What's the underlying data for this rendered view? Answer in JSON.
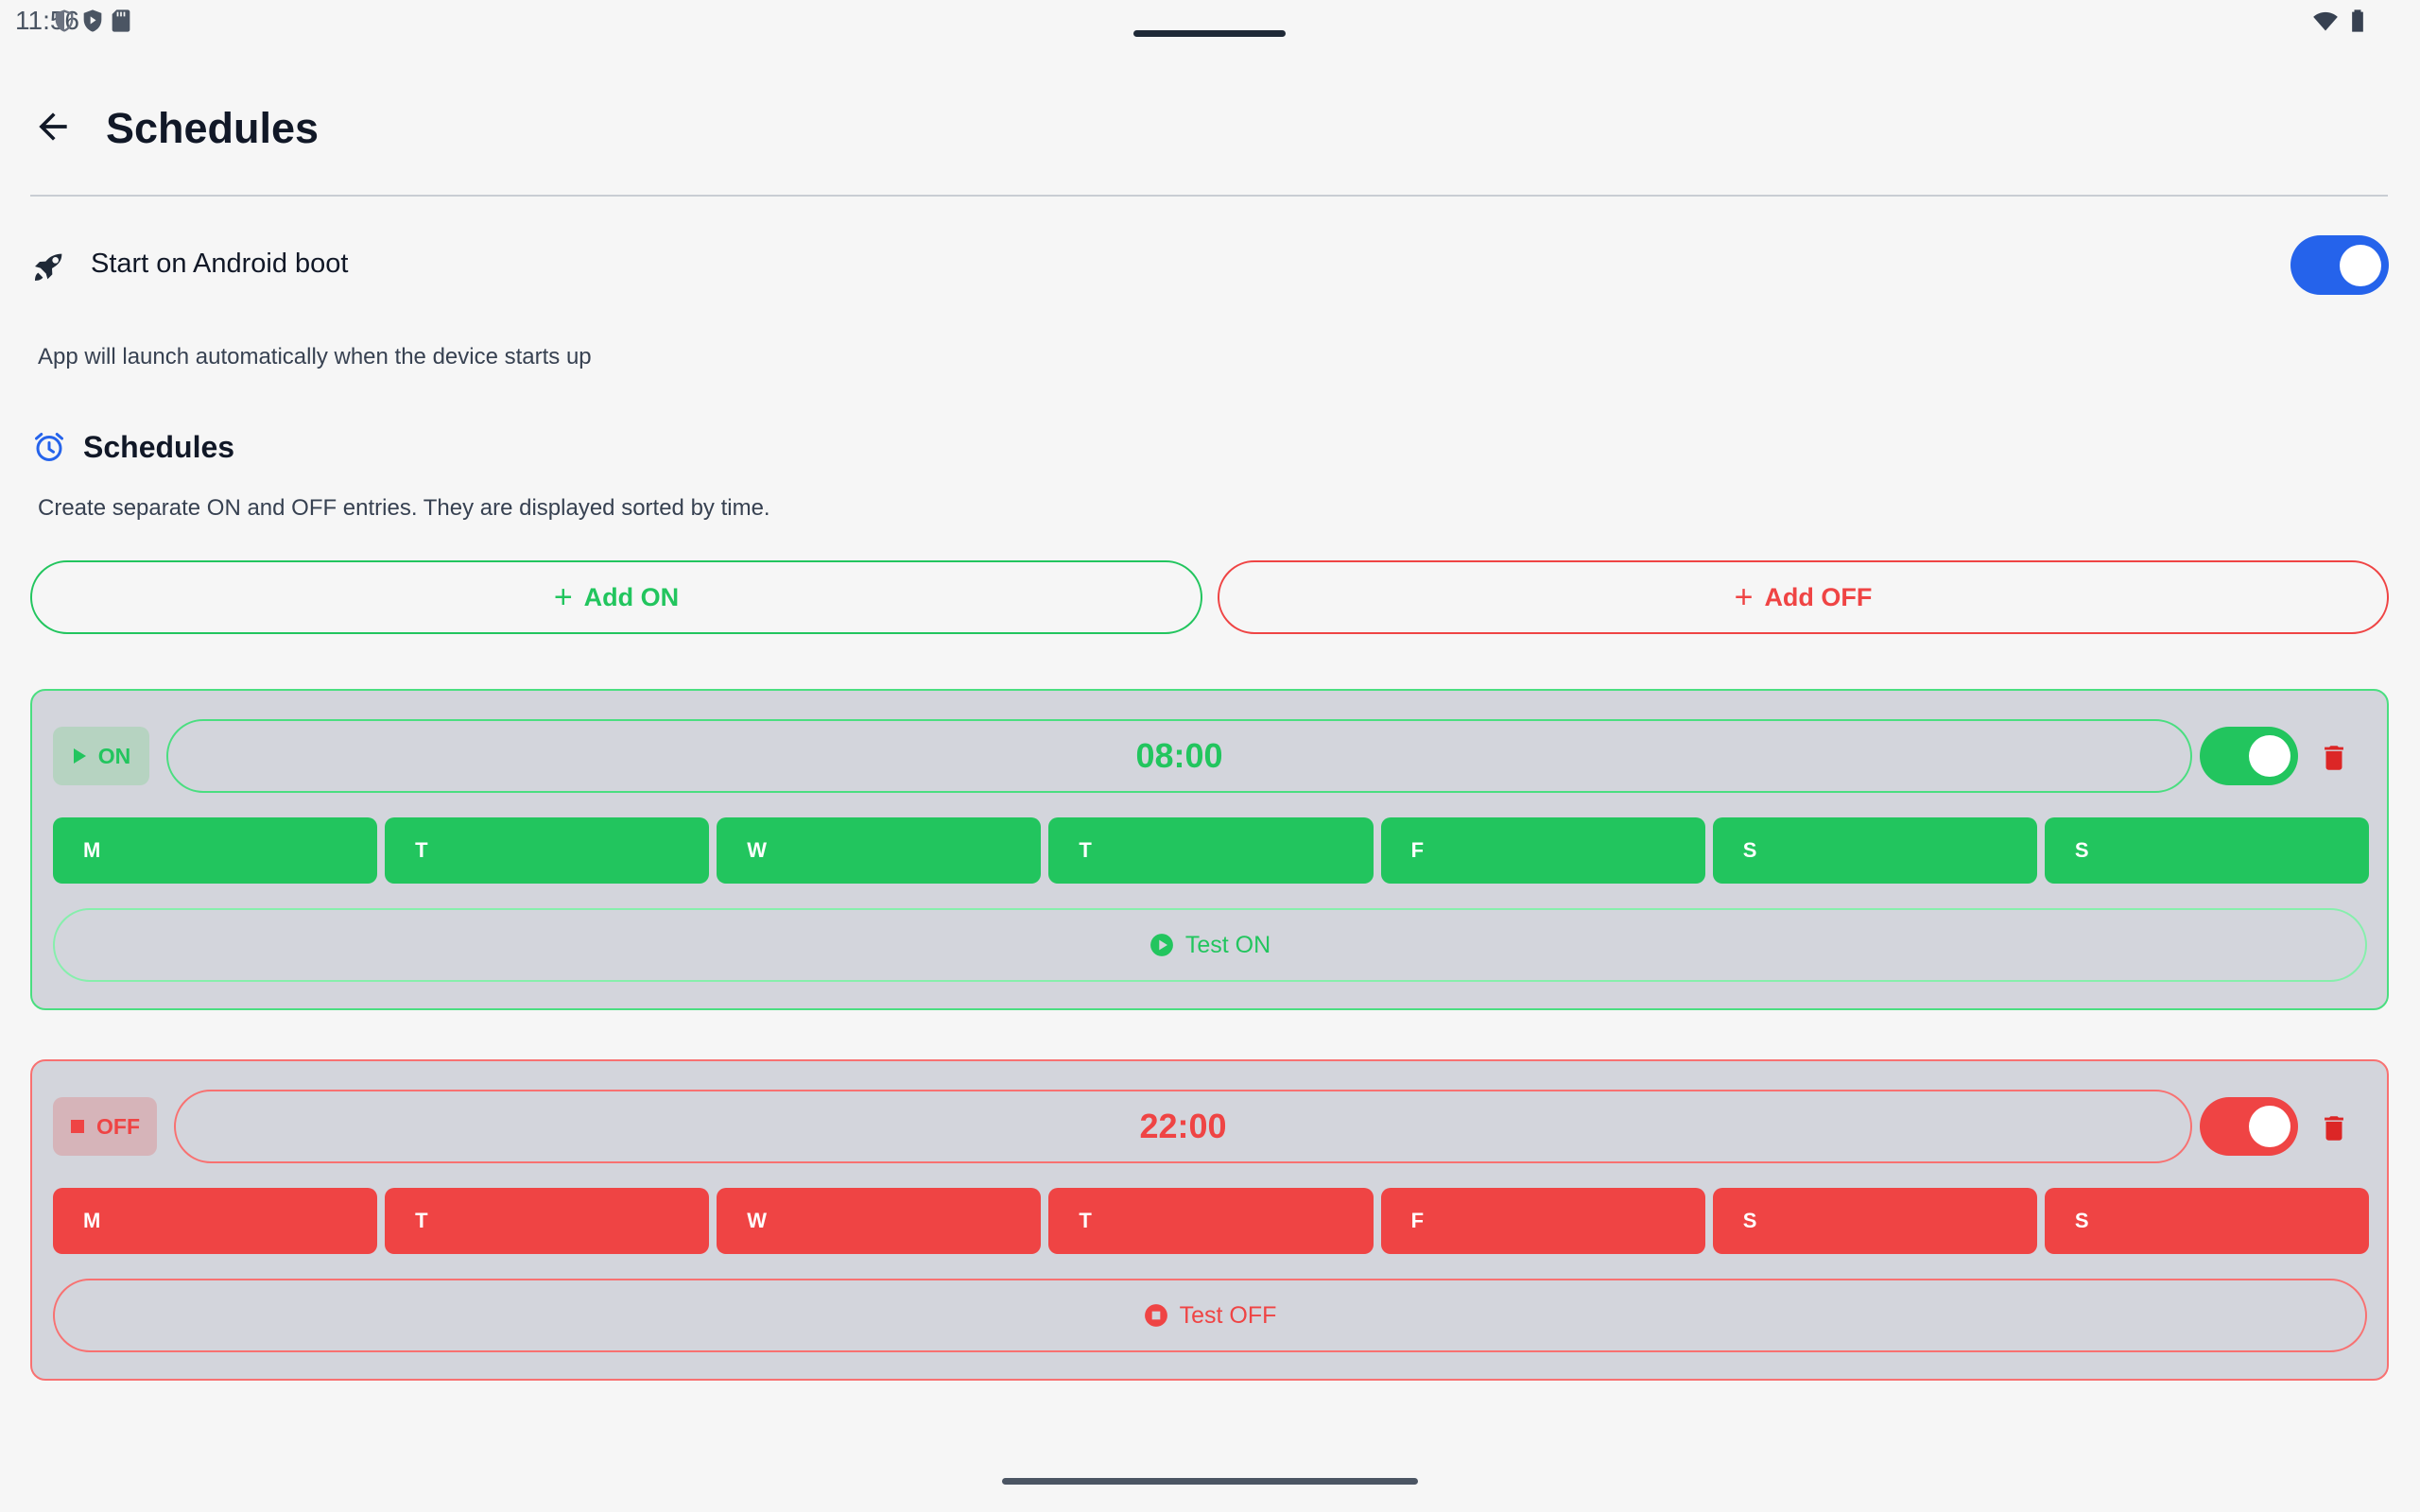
{
  "status_bar": {
    "time": "11:56"
  },
  "header": {
    "title": "Schedules"
  },
  "boot": {
    "label": "Start on Android boot",
    "enabled": true,
    "description": "App will launch automatically when the device starts up"
  },
  "schedules_section": {
    "title": "Schedules",
    "description": "Create separate ON and OFF entries. They are displayed sorted by time.",
    "add_on_label": "Add ON",
    "add_off_label": "Add OFF"
  },
  "entries": [
    {
      "type_label": "ON",
      "time": "08:00",
      "enabled": true,
      "days": [
        "M",
        "T",
        "W",
        "T",
        "F",
        "S",
        "S"
      ],
      "test_label": "Test ON"
    },
    {
      "type_label": "OFF",
      "time": "22:00",
      "enabled": true,
      "days": [
        "M",
        "T",
        "W",
        "T",
        "F",
        "S",
        "S"
      ],
      "test_label": "Test OFF"
    }
  ],
  "colors": {
    "on": "#22c55e",
    "off": "#ef4444",
    "accent": "#2563eb",
    "card_bg": "#d3d5dc",
    "background": "#f6f6f6"
  },
  "icons": {
    "back": "arrow-left-icon",
    "boot": "rocket-icon",
    "section": "alarm-clock-icon",
    "delete": "trash-icon",
    "test_on": "play-circle-icon",
    "test_off": "stop-circle-icon"
  }
}
